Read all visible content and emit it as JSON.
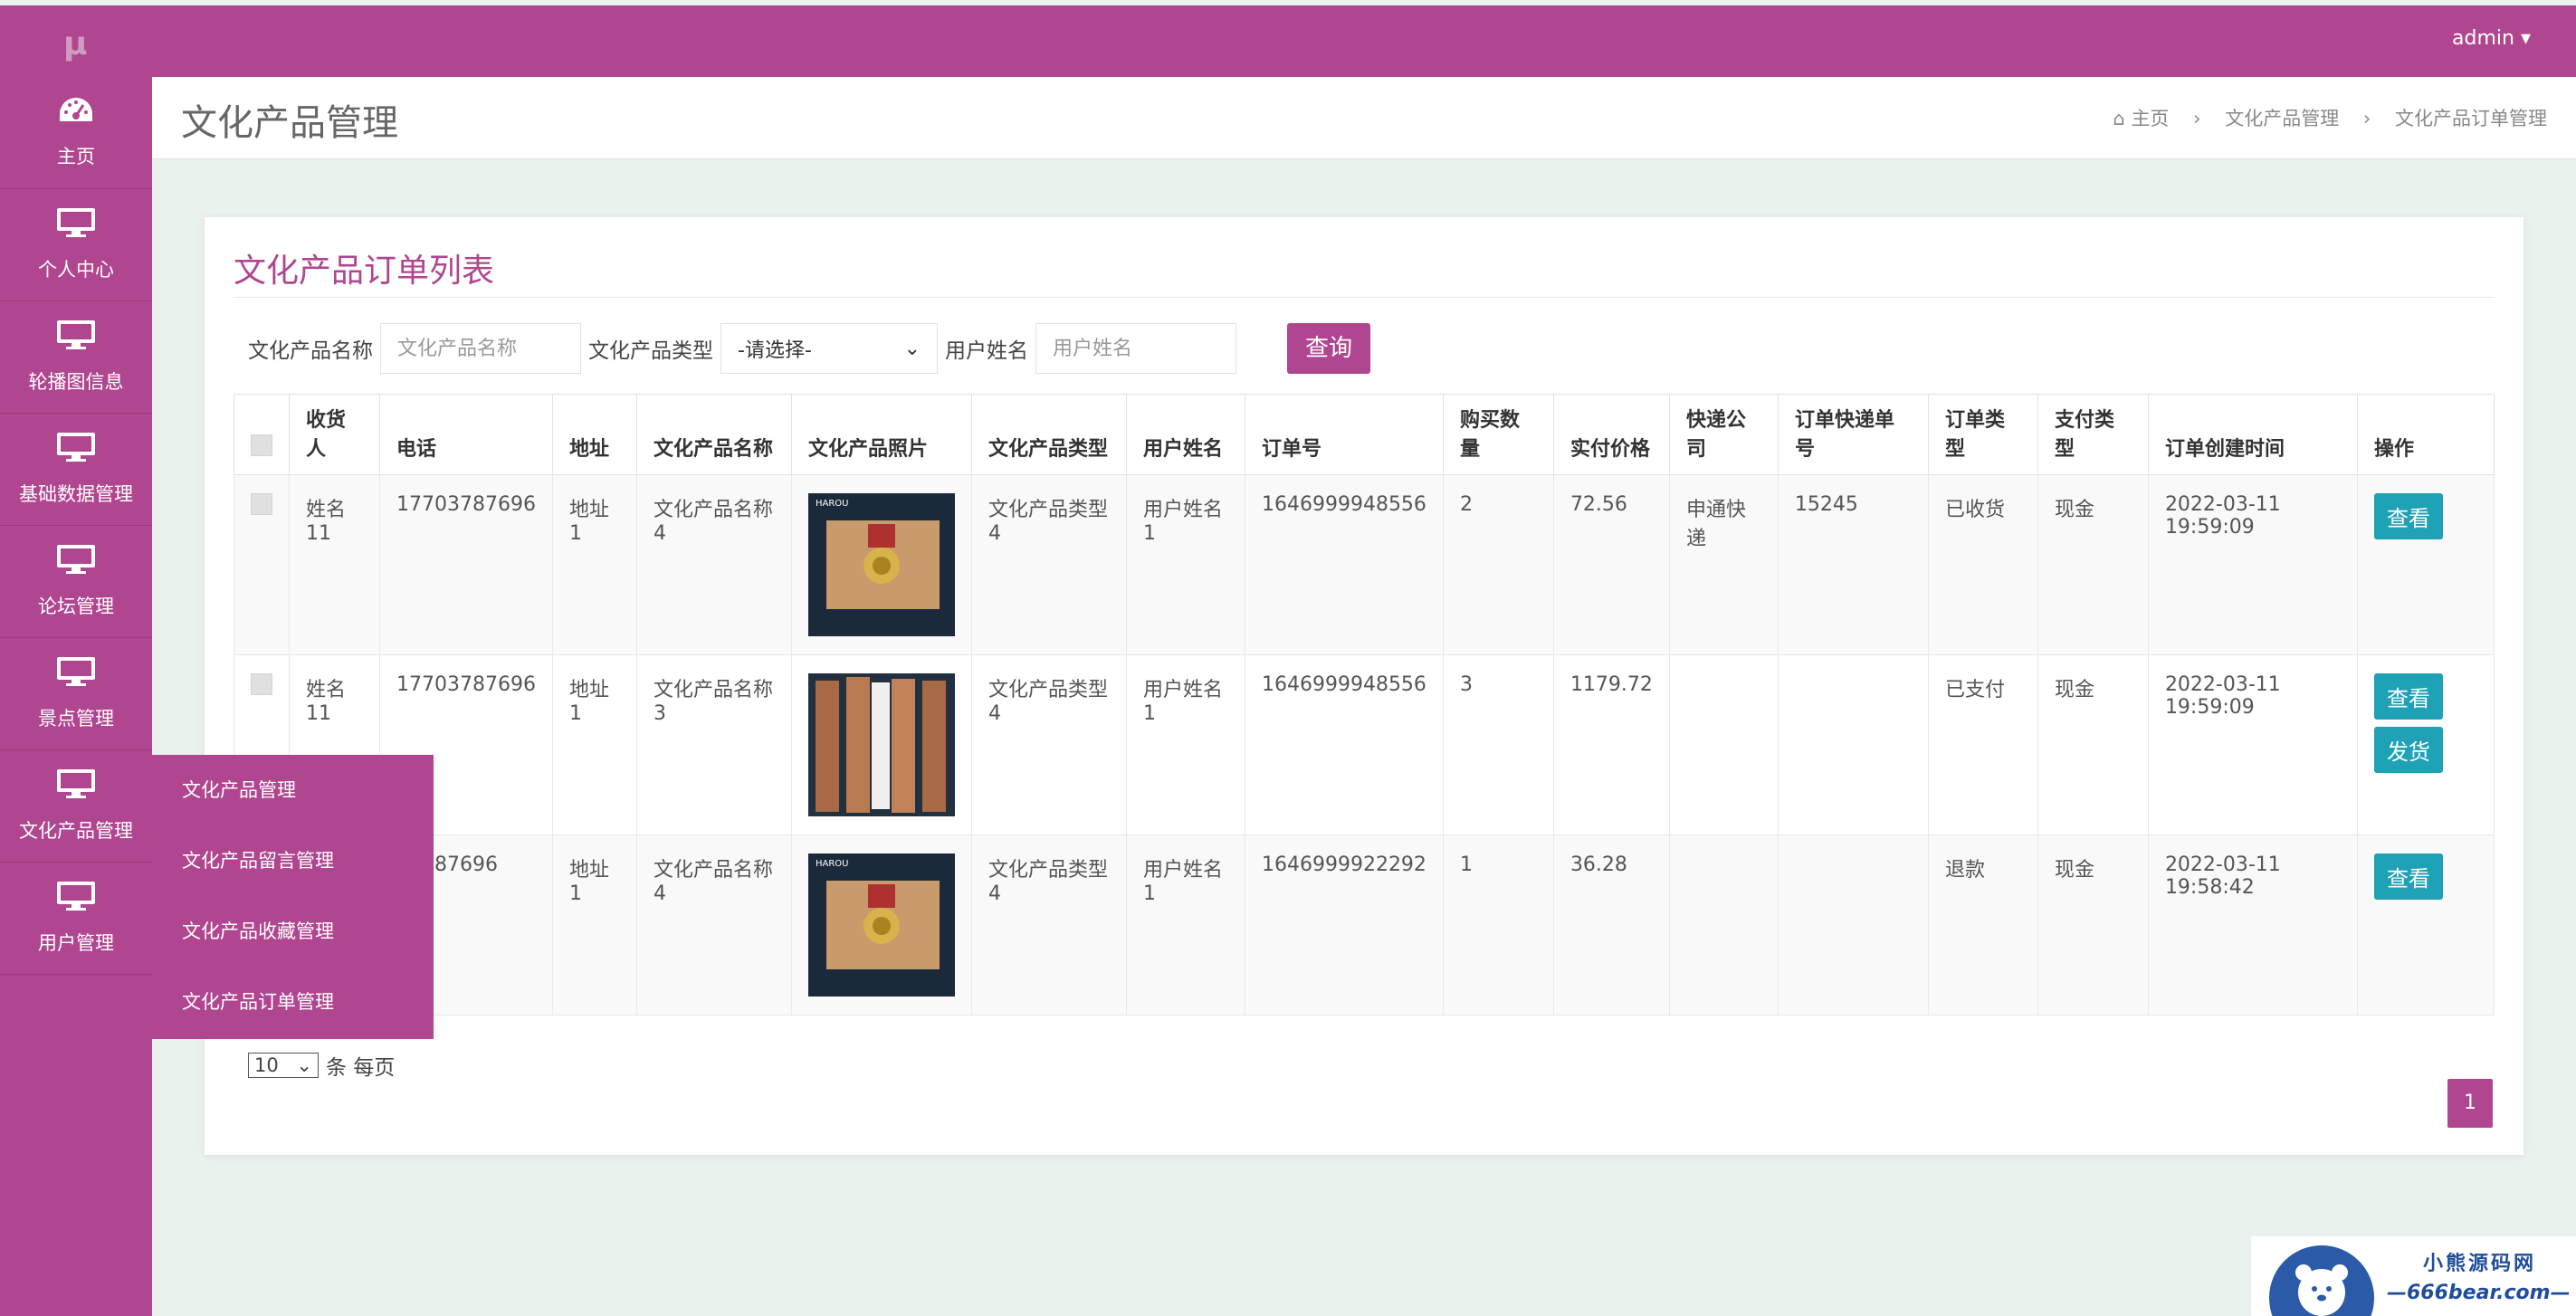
{
  "app": {
    "logo": "μ",
    "user_menu": "admin ▾"
  },
  "sidebar": {
    "items": [
      {
        "label": "主页",
        "icon": "dashboard-icon"
      },
      {
        "label": "个人中心",
        "icon": "monitor-icon"
      },
      {
        "label": "轮播图信息",
        "icon": "monitor-icon"
      },
      {
        "label": "基础数据管理",
        "icon": "monitor-icon"
      },
      {
        "label": "论坛管理",
        "icon": "monitor-icon"
      },
      {
        "label": "景点管理",
        "icon": "monitor-icon"
      },
      {
        "label": "文化产品管理",
        "icon": "monitor-icon"
      },
      {
        "label": "用户管理",
        "icon": "monitor-icon"
      }
    ],
    "submenu": [
      "文化产品管理",
      "文化产品留言管理",
      "文化产品收藏管理",
      "文化产品订单管理"
    ]
  },
  "header": {
    "title": "文化产品管理",
    "breadcrumb": [
      "主页",
      "文化产品管理",
      "文化产品订单管理"
    ]
  },
  "card": {
    "title": "文化产品订单列表"
  },
  "search": {
    "name_label": "文化产品名称",
    "name_placeholder": "文化产品名称",
    "type_label": "文化产品类型",
    "type_value": "-请选择-",
    "user_label": "用户姓名",
    "user_placeholder": "用户姓名",
    "query_button": "查询"
  },
  "table": {
    "headers": [
      "收货人",
      "电话",
      "地址",
      "文化产品名称",
      "文化产品照片",
      "文化产品类型",
      "用户姓名",
      "订单号",
      "购买数量",
      "实付价格",
      "快递公司",
      "订单快递单号",
      "订单类型",
      "支付类型",
      "订单创建时间",
      "操作"
    ],
    "rows": [
      {
        "receiver": "姓名11",
        "phone": "17703787696",
        "address": "地址1",
        "product": "文化产品名称4",
        "photo": "medal",
        "ptype": "文化产品类型4",
        "user": "用户姓名1",
        "order_no": "1646999948556",
        "qty": "2",
        "price": "72.56",
        "express": "申通快递",
        "tracking": "15245",
        "otype": "已收货",
        "paytype": "现金",
        "created": "2022-03-11 19:59:09",
        "actions": [
          "查看"
        ]
      },
      {
        "receiver": "姓名11",
        "phone": "17703787696",
        "address": "地址1",
        "product": "文化产品名称3",
        "photo": "bookmarks",
        "ptype": "文化产品类型4",
        "user": "用户姓名1",
        "order_no": "1646999948556",
        "qty": "3",
        "price": "1179.72",
        "express": "",
        "tracking": "",
        "otype": "已支付",
        "paytype": "现金",
        "created": "2022-03-11 19:59:09",
        "actions": [
          "查看",
          "发货"
        ]
      },
      {
        "receiver": "",
        "phone": "03787696",
        "address": "地址1",
        "product": "文化产品名称4",
        "photo": "medal",
        "ptype": "文化产品类型4",
        "user": "用户姓名1",
        "order_no": "1646999922292",
        "qty": "1",
        "price": "36.28",
        "express": "",
        "tracking": "",
        "otype": "退款",
        "paytype": "现金",
        "created": "2022-03-11 19:58:42",
        "actions": [
          "查看"
        ]
      }
    ]
  },
  "pager": {
    "page_size": "10",
    "suffix": "条 每页",
    "current_page": "1"
  },
  "watermark": {
    "line1": "小熊源码网",
    "line2": "—666bear.com—"
  },
  "colors": {
    "brand": "#b0468f",
    "action": "#1fa1b6"
  }
}
